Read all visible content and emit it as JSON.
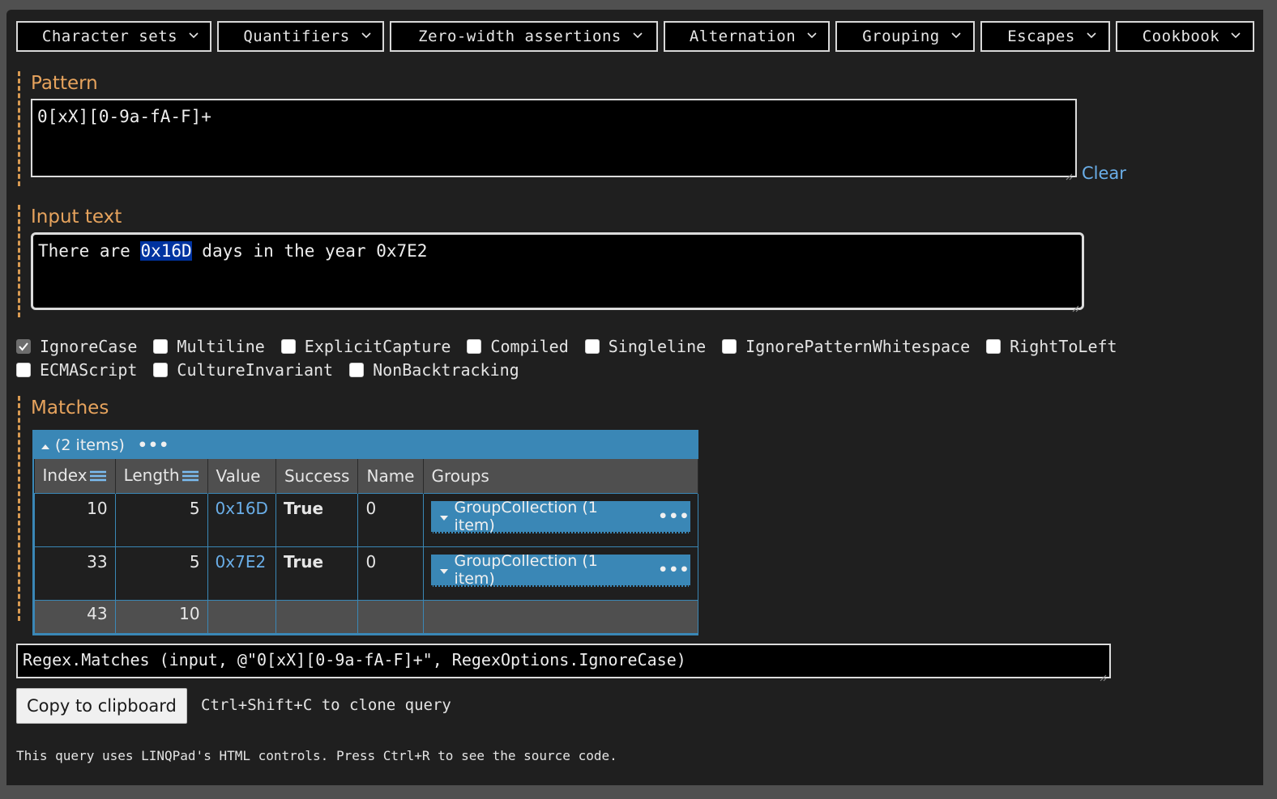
{
  "toolbar": {
    "menus": [
      {
        "label": "Character sets",
        "icon": "chevron-down-icon"
      },
      {
        "label": "Quantifiers",
        "icon": "chevron-down-icon"
      },
      {
        "label": "Zero-width assertions",
        "icon": "chevron-down-icon"
      },
      {
        "label": "Alternation",
        "icon": "chevron-down-icon"
      },
      {
        "label": "Grouping",
        "icon": "chevron-down-icon"
      },
      {
        "label": "Escapes",
        "icon": "chevron-down-icon"
      },
      {
        "label": "Cookbook",
        "icon": "chevron-down-icon"
      }
    ]
  },
  "pattern": {
    "title": "Pattern",
    "value": "0[xX][0-9a-fA-F]+",
    "clear_label": "Clear"
  },
  "input": {
    "title": "Input text",
    "before": "There are ",
    "highlighted": "0x16D",
    "after": " days in the year 0x7E2"
  },
  "options": {
    "row1": [
      {
        "label": "IgnoreCase",
        "checked": true
      },
      {
        "label": "Multiline",
        "checked": false
      },
      {
        "label": "ExplicitCapture",
        "checked": false
      },
      {
        "label": "Compiled",
        "checked": false
      },
      {
        "label": "Singleline",
        "checked": false
      },
      {
        "label": "IgnorePatternWhitespace",
        "checked": false
      },
      {
        "label": "RightToLeft",
        "checked": false
      }
    ],
    "row2": [
      {
        "label": "ECMAScript",
        "checked": false
      },
      {
        "label": "CultureInvariant",
        "checked": false
      },
      {
        "label": "NonBacktracking",
        "checked": false
      }
    ]
  },
  "matches": {
    "title": "Matches",
    "header_label": "(2 items)",
    "more": "•••",
    "columns": [
      "Index",
      "Length",
      "Value",
      "Success",
      "Name",
      "Groups"
    ],
    "rows": [
      {
        "index": "10",
        "length": "5",
        "value": "0x16D",
        "success": "True",
        "name": "0",
        "groups": "GroupCollection (1 item)"
      },
      {
        "index": "33",
        "length": "5",
        "value": "0x7E2",
        "success": "True",
        "name": "0",
        "groups": "GroupCollection (1 item)"
      }
    ],
    "totals": {
      "index": "43",
      "length": "10"
    }
  },
  "query": {
    "value": "Regex.Matches (input, @\"0[xX][0-9a-fA-F]+\", RegexOptions.IgnoreCase)",
    "copy_label": "Copy to clipboard",
    "hint": "Ctrl+Shift+C to clone query"
  },
  "footer": "This query uses LINQPad's HTML controls. Press Ctrl+R to see the source code.",
  "colors": {
    "accent_orange": "#e6a35d",
    "link_blue": "#6aaee8",
    "table_blue": "#3a87b6",
    "highlight": "#0033a0"
  }
}
